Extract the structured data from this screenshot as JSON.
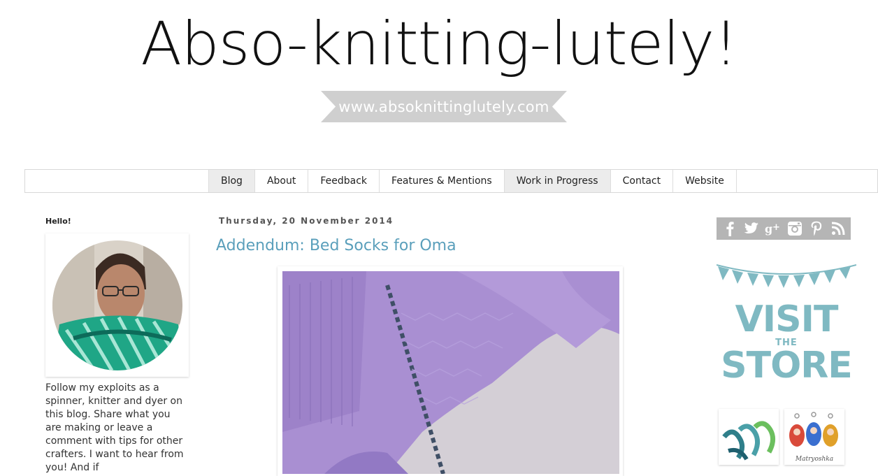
{
  "header": {
    "title": "Abso-knitting-lutely!",
    "url_banner": "www.absoknittinglutely.com"
  },
  "nav": {
    "tabs": [
      {
        "label": "Blog",
        "active": true
      },
      {
        "label": "About",
        "active": false
      },
      {
        "label": "Feedback",
        "active": false
      },
      {
        "label": "Features & Mentions",
        "active": false
      },
      {
        "label": "Work in Progress",
        "active": false
      },
      {
        "label": "Contact",
        "active": false
      },
      {
        "label": "Website",
        "active": false
      }
    ]
  },
  "sidebar_left": {
    "hello_title": "Hello!",
    "about_text": "Follow my exploits as a spinner, knitter and dyer on this blog. Share what you are making or leave a comment with tips for other crafters. I want to hear from you! And if"
  },
  "post": {
    "date": "Thursday, 20 November 2014",
    "title": "Addendum: Bed Socks for Oma"
  },
  "sidebar_right": {
    "social_icons": [
      "facebook-icon",
      "twitter-icon",
      "google-plus-icon",
      "instagram-icon",
      "pinterest-icon",
      "rss-icon"
    ],
    "store_visit": "VISIT",
    "store_the": "THE",
    "store_store": "STORE",
    "thumb_caption": "Matryoshka"
  },
  "colors": {
    "accent_title": "#5a9fbb",
    "store_teal": "#7fb9c2",
    "banner_gray": "#cfcfcf",
    "social_bar": "#b5b5b5"
  }
}
